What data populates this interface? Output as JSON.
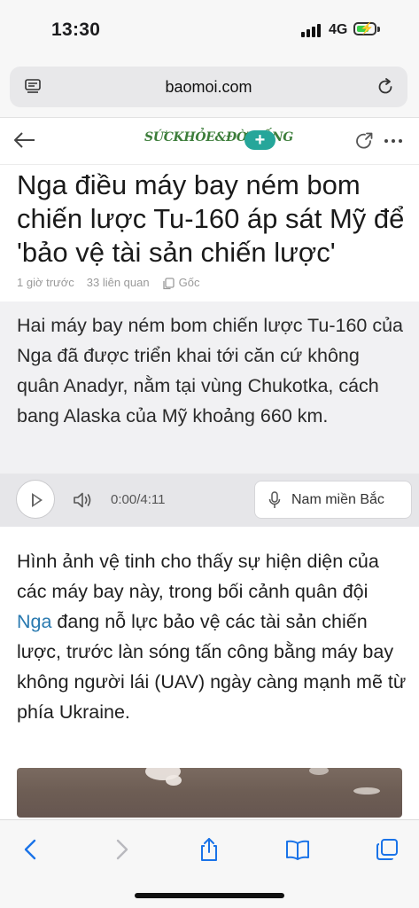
{
  "status_bar": {
    "time": "13:30",
    "network": "4G"
  },
  "browser": {
    "url": "baomoi.com",
    "icons": [
      "reader-icon",
      "reload-icon"
    ]
  },
  "site_header": {
    "brand": "SỨCKHỎE&ĐỜISỐNG",
    "plus_label": "+",
    "icons": [
      "back-arrow-icon",
      "share-icon",
      "more-icon"
    ]
  },
  "article": {
    "headline": "Nga điều máy bay ném bom chiến lược Tu-160 áp sát Mỹ để 'bảo vệ tài sản chiến lược'",
    "meta": {
      "time_ago": "1 giờ trước",
      "related": "33 liên quan",
      "source": "Gốc"
    },
    "summary": "Hai máy bay ném bom chiến lược Tu-160 của Nga đã được triển khai tới căn cứ không quân Anadyr, nằm tại vùng Chukotka, cách bang Alaska của Mỹ khoảng 660 km.",
    "audio": {
      "time": "0:00/4:11",
      "voice": "Nam miền Bắc"
    },
    "body_before_link": "Hình ảnh vệ tinh cho thấy sự hiện diện của các máy bay này, trong bối cảnh quân đội ",
    "body_link": "Nga",
    "body_after_link": " đang nỗ lực bảo vệ các tài sản chiến lược, trước làn sóng tấn công bằng máy bay không người lái (UAV) ngày càng mạnh mẽ từ phía Ukraine."
  },
  "toolbar": {
    "icons": [
      "back-icon",
      "forward-icon",
      "share-icon",
      "bookmarks-icon",
      "tabs-icon"
    ]
  },
  "colors": {
    "accent_blue": "#1a73e8",
    "link": "#2a7ab0",
    "brand_green": "#3c7d3a",
    "plus_teal": "#26a69a",
    "battery_green": "#3ad04a"
  }
}
